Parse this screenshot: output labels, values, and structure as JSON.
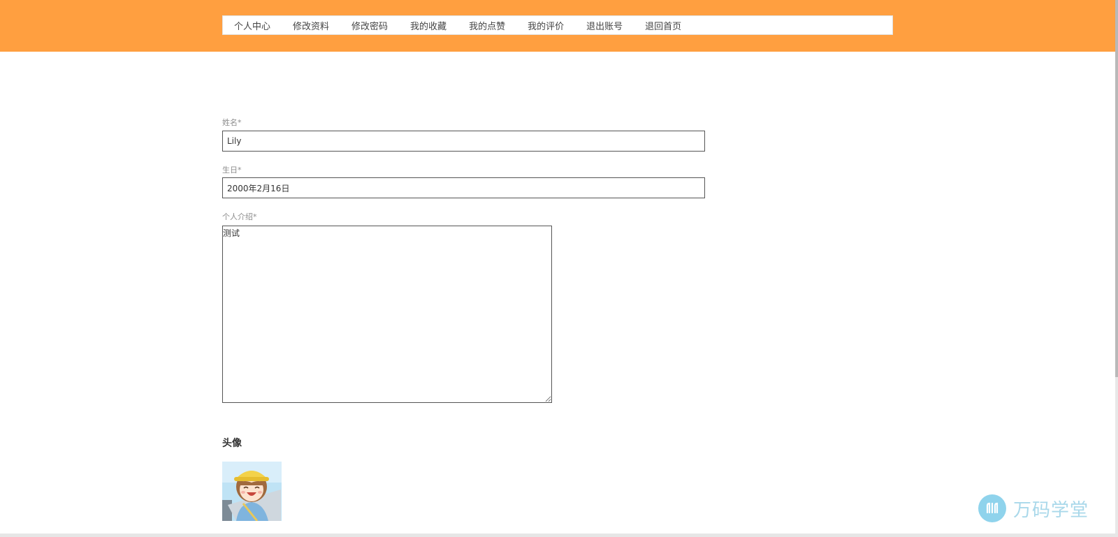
{
  "nav": {
    "items": [
      "个人中心",
      "修改资料",
      "修改密码",
      "我的收藏",
      "我的点赞",
      "我的评价",
      "退出账号",
      "退回首页"
    ]
  },
  "form": {
    "name_label": "姓名*",
    "name_value": "Lily",
    "birthday_label": "生日*",
    "birthday_value": "2000年2月16日",
    "intro_label": "个人介绍*",
    "intro_value": "测试"
  },
  "avatar": {
    "heading": "头像"
  },
  "watermark": {
    "text": "万码学堂"
  },
  "colors": {
    "header_bg": "#ff9f40",
    "logo": "#8fd3ec"
  }
}
